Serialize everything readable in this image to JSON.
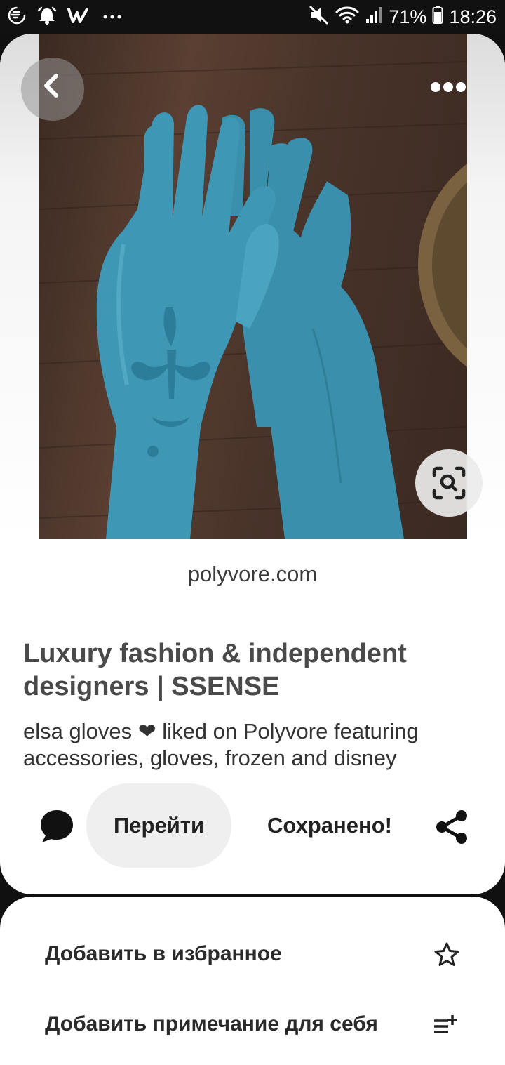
{
  "status_bar": {
    "left_icons": [
      "data-saver-icon",
      "alarm-icon",
      "w-app-icon",
      "more-notifications-icon"
    ],
    "battery_text": "71%",
    "time": "18:26"
  },
  "pin": {
    "image_subject": "blue-elsa-gloves",
    "source_domain": "polyvore.com",
    "title": "Luxury fashion & independent designers | SSENSE",
    "description": "elsa gloves ❤ liked on Polyvore featuring accessories, gloves, frozen and disney"
  },
  "actions": {
    "comment_icon": "comment-bubble-icon",
    "visit_label": "Перейти",
    "saved_label": "Сохранено!",
    "share_icon": "share-icon"
  },
  "sheet": {
    "items": [
      {
        "label": "Добавить в избранное",
        "icon": "star-icon"
      },
      {
        "label": "Добавить примечание для себя",
        "icon": "add-note-icon"
      }
    ]
  },
  "colors": {
    "glove_blue": "#3d97b5",
    "wood_dark": "#4a342a",
    "button_gray": "#efefef"
  }
}
